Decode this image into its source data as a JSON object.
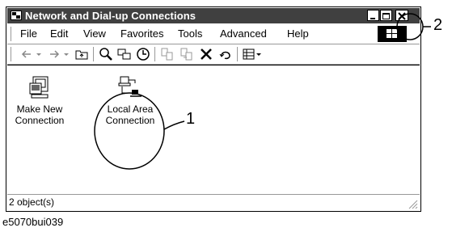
{
  "window": {
    "title": "Network and Dial-up Connections"
  },
  "menubar": {
    "items": [
      "File",
      "Edit",
      "View",
      "Favorites",
      "Tools",
      "Advanced",
      "Help"
    ]
  },
  "toolbar": {
    "icons": [
      "back-icon",
      "forward-icon",
      "up-folder-icon",
      "search-icon",
      "folders-icon",
      "history-icon",
      "move-to-icon",
      "copy-to-icon",
      "delete-icon",
      "undo-icon",
      "views-icon"
    ]
  },
  "content": {
    "items": [
      {
        "line1": "Make New",
        "line2": "Connection"
      },
      {
        "line1": "Local Area",
        "line2": "Connection"
      }
    ]
  },
  "status": {
    "text": "2 object(s)"
  },
  "caption": "e5070bui039",
  "callouts": {
    "one": "1",
    "two": "2"
  }
}
